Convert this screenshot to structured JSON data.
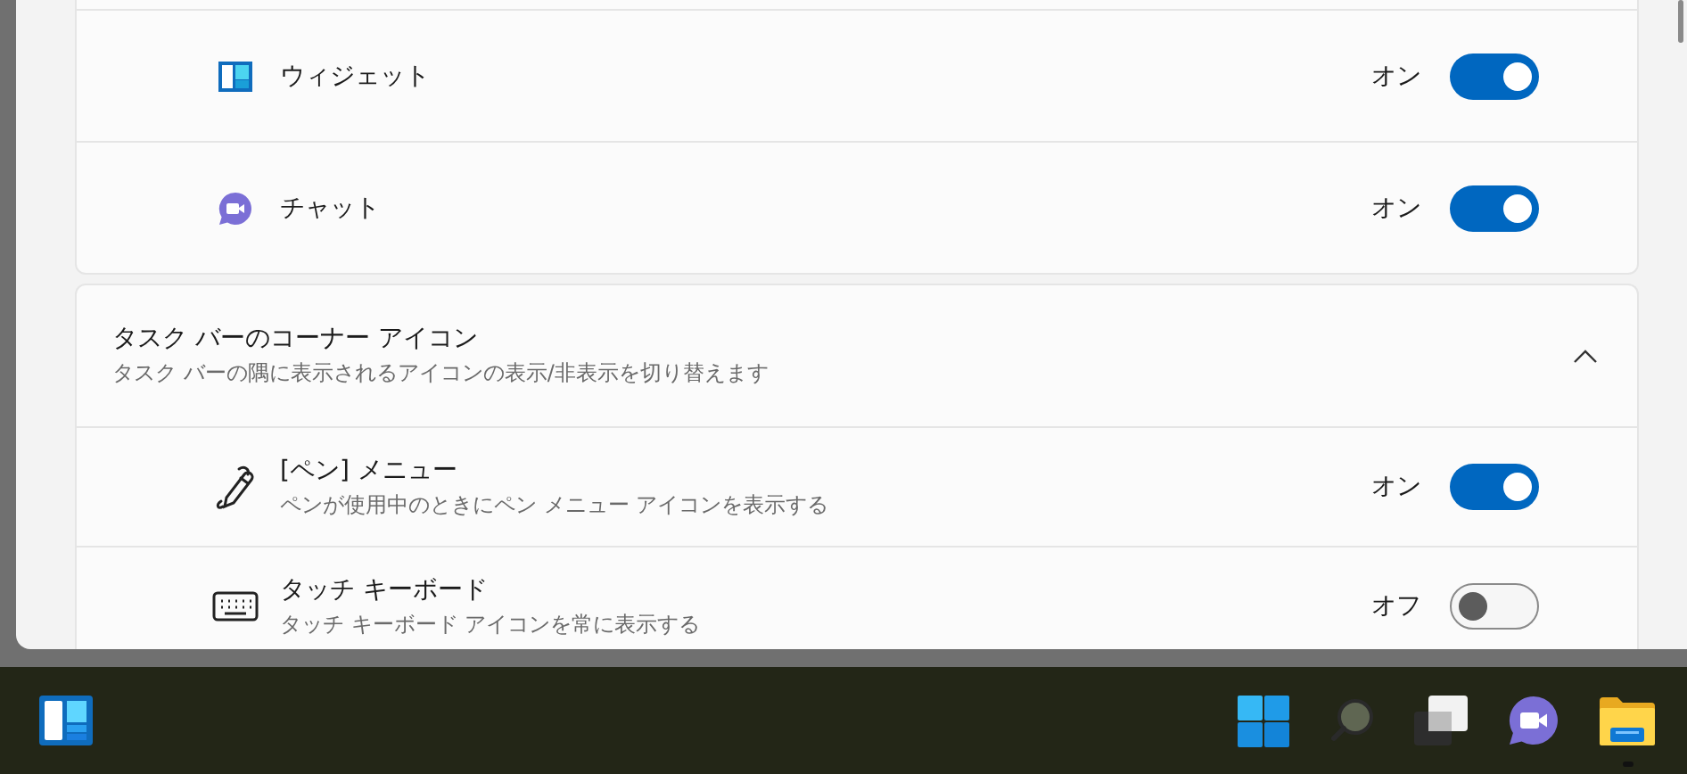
{
  "settings_cards": [
    {
      "rows": [
        {
          "kind": "widgets",
          "label": "ウィジェット",
          "state_text": "オン",
          "on": true
        },
        {
          "kind": "chat",
          "label": "チャット",
          "state_text": "オン",
          "on": true
        }
      ]
    },
    {
      "header": {
        "title": "タスク バーのコーナー アイコン",
        "subtitle": "タスク バーの隅に表示されるアイコンの表示/非表示を切り替えます",
        "expanded": true
      },
      "rows": [
        {
          "kind": "pen",
          "label": "[ペン] メニュー",
          "description": "ペンが使用中のときにペン メニュー アイコンを表示する",
          "state_text": "オン",
          "on": true
        },
        {
          "kind": "keyboard",
          "label": "タッチ キーボード",
          "description": "タッチ キーボード アイコンを常に表示する",
          "state_text": "オフ",
          "on": false
        }
      ]
    }
  ],
  "taskbar": {
    "items": [
      {
        "kind": "widgets",
        "running": false
      },
      {
        "kind": "start",
        "running": false
      },
      {
        "kind": "search",
        "running": false
      },
      {
        "kind": "task-view",
        "running": false
      },
      {
        "kind": "chat",
        "running": false
      },
      {
        "kind": "explorer",
        "running": true
      }
    ]
  }
}
